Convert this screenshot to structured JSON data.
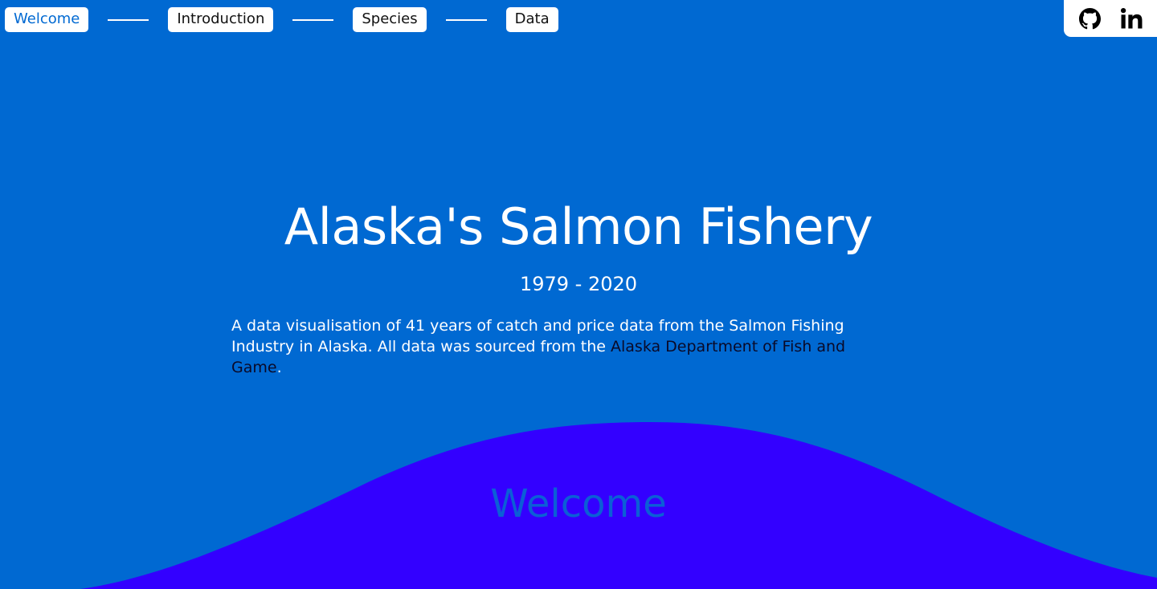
{
  "nav": {
    "items": [
      {
        "label": "Welcome",
        "active": true
      },
      {
        "label": "Introduction",
        "active": false
      },
      {
        "label": "Species",
        "active": false
      },
      {
        "label": "Data",
        "active": false
      }
    ]
  },
  "social": {
    "github_icon": "github-icon",
    "linkedin_icon": "linkedin-icon"
  },
  "hero": {
    "title": "Alaska's Salmon Fishery",
    "years": "1979 - 2020",
    "description_before": "A data visualisation of 41 years of catch and price data from the Salmon Fishing Industry in Alaska. All data was sourced from the ",
    "link_text": "Alaska Department of Fish and Game",
    "description_after": "."
  },
  "section": {
    "label": "Welcome"
  },
  "colors": {
    "background": "#0069d2",
    "wave": "#3300ff",
    "section_label": "#0b5fd6",
    "link": "#0a0a28"
  }
}
